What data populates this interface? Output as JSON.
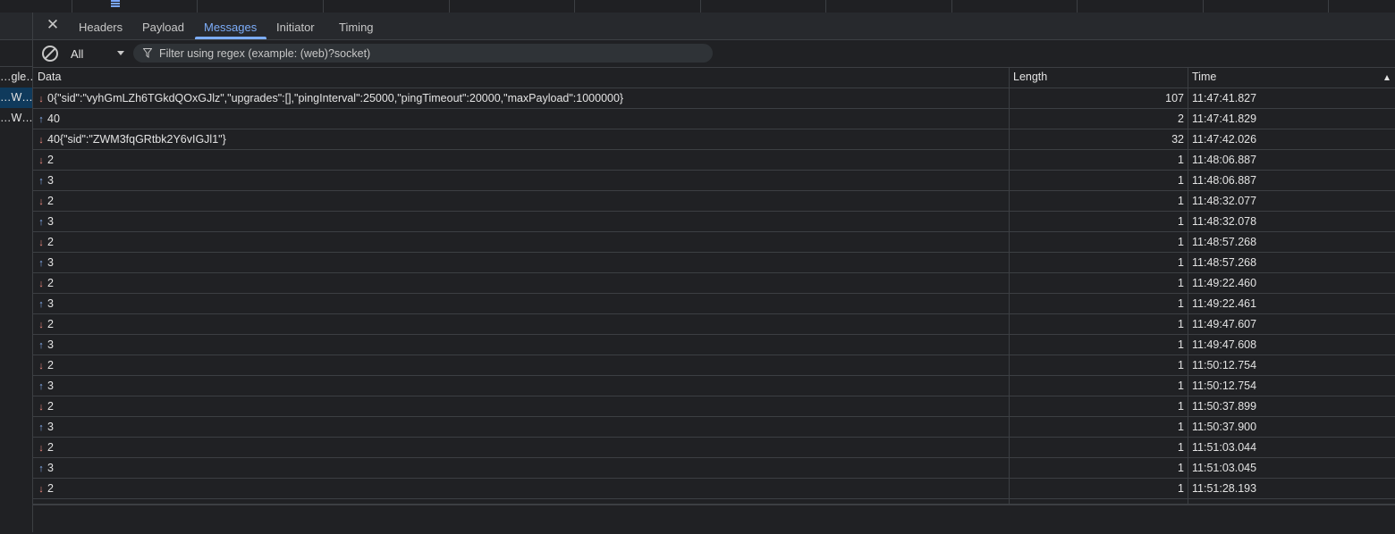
{
  "sidebar": {
    "items": [
      {
        "label": "…gle…",
        "selected": false
      },
      {
        "label": "…W…",
        "selected": true
      },
      {
        "label": "…W…",
        "selected": false
      }
    ]
  },
  "tabs": [
    {
      "label": "Headers",
      "active": false
    },
    {
      "label": "Payload",
      "active": false
    },
    {
      "label": "Messages",
      "active": true
    },
    {
      "label": "Initiator",
      "active": false
    },
    {
      "label": "Timing",
      "active": false
    }
  ],
  "toolbar": {
    "filter_select": "All",
    "filter_placeholder": "Filter using regex (example: (web)?socket)"
  },
  "grid": {
    "columns": {
      "data": "Data",
      "length": "Length",
      "time": "Time"
    },
    "sort": "time-ascending",
    "rows": [
      {
        "dir": "down",
        "data": "0{\"sid\":\"vyhGmLZh6TGkdQOxGJlz\",\"upgrades\":[],\"pingInterval\":25000,\"pingTimeout\":20000,\"maxPayload\":1000000}",
        "length": "107",
        "time": "11:47:41.827"
      },
      {
        "dir": "up",
        "data": "40",
        "length": "2",
        "time": "11:47:41.829"
      },
      {
        "dir": "down",
        "data": "40{\"sid\":\"ZWM3fqGRtbk2Y6vIGJl1\"}",
        "length": "32",
        "time": "11:47:42.026"
      },
      {
        "dir": "down",
        "data": "2",
        "length": "1",
        "time": "11:48:06.887"
      },
      {
        "dir": "up",
        "data": "3",
        "length": "1",
        "time": "11:48:06.887"
      },
      {
        "dir": "down",
        "data": "2",
        "length": "1",
        "time": "11:48:32.077"
      },
      {
        "dir": "up",
        "data": "3",
        "length": "1",
        "time": "11:48:32.078"
      },
      {
        "dir": "down",
        "data": "2",
        "length": "1",
        "time": "11:48:57.268"
      },
      {
        "dir": "up",
        "data": "3",
        "length": "1",
        "time": "11:48:57.268"
      },
      {
        "dir": "down",
        "data": "2",
        "length": "1",
        "time": "11:49:22.460"
      },
      {
        "dir": "up",
        "data": "3",
        "length": "1",
        "time": "11:49:22.461"
      },
      {
        "dir": "down",
        "data": "2",
        "length": "1",
        "time": "11:49:47.607"
      },
      {
        "dir": "up",
        "data": "3",
        "length": "1",
        "time": "11:49:47.608"
      },
      {
        "dir": "down",
        "data": "2",
        "length": "1",
        "time": "11:50:12.754"
      },
      {
        "dir": "up",
        "data": "3",
        "length": "1",
        "time": "11:50:12.754"
      },
      {
        "dir": "down",
        "data": "2",
        "length": "1",
        "time": "11:50:37.899"
      },
      {
        "dir": "up",
        "data": "3",
        "length": "1",
        "time": "11:50:37.900"
      },
      {
        "dir": "down",
        "data": "2",
        "length": "1",
        "time": "11:51:03.044"
      },
      {
        "dir": "up",
        "data": "3",
        "length": "1",
        "time": "11:51:03.045"
      },
      {
        "dir": "down",
        "data": "2",
        "length": "1",
        "time": "11:51:28.193"
      }
    ]
  },
  "colors": {
    "accent": "#7cacf8",
    "arrow_down": "#f28b82",
    "arrow_up": "#8ab4f8",
    "background": "#202124",
    "selected_row": "#0f3a5c"
  }
}
